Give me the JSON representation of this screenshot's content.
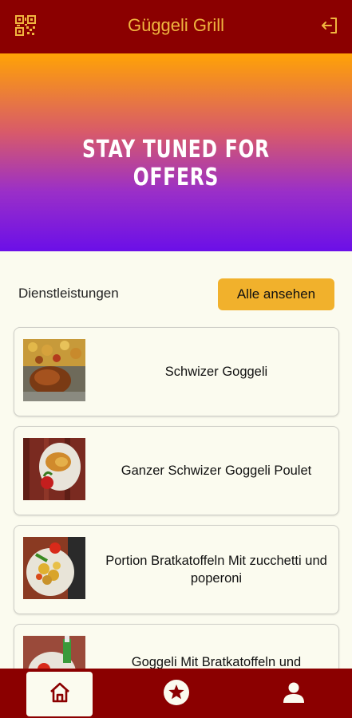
{
  "header": {
    "title": "Güggeli Grill",
    "left_icon": "qr-code-icon",
    "right_icon": "logout-icon"
  },
  "banner": {
    "text": "STAY TUNED FOR OFFERS"
  },
  "services": {
    "label": "Dienstleistungen",
    "see_all_label": "Alle ansehen",
    "items": [
      {
        "name": "Schwizer Goggeli"
      },
      {
        "name": "Ganzer Schwizer  Goggeli  Poulet"
      },
      {
        "name": "Portion Bratkatoffeln Mit zucchetti und poperoni"
      },
      {
        "name": "Goggeli   Mit Bratkatoffeln  und"
      }
    ]
  },
  "bottom_nav": {
    "items": [
      {
        "icon": "home-icon",
        "active": true
      },
      {
        "icon": "star-icon",
        "active": false
      },
      {
        "icon": "profile-icon",
        "active": false
      }
    ]
  },
  "colors": {
    "header_bg": "#8b0000",
    "title": "#f0b53f",
    "accent_button": "#f1b12c",
    "page_bg": "#fbfbef"
  }
}
